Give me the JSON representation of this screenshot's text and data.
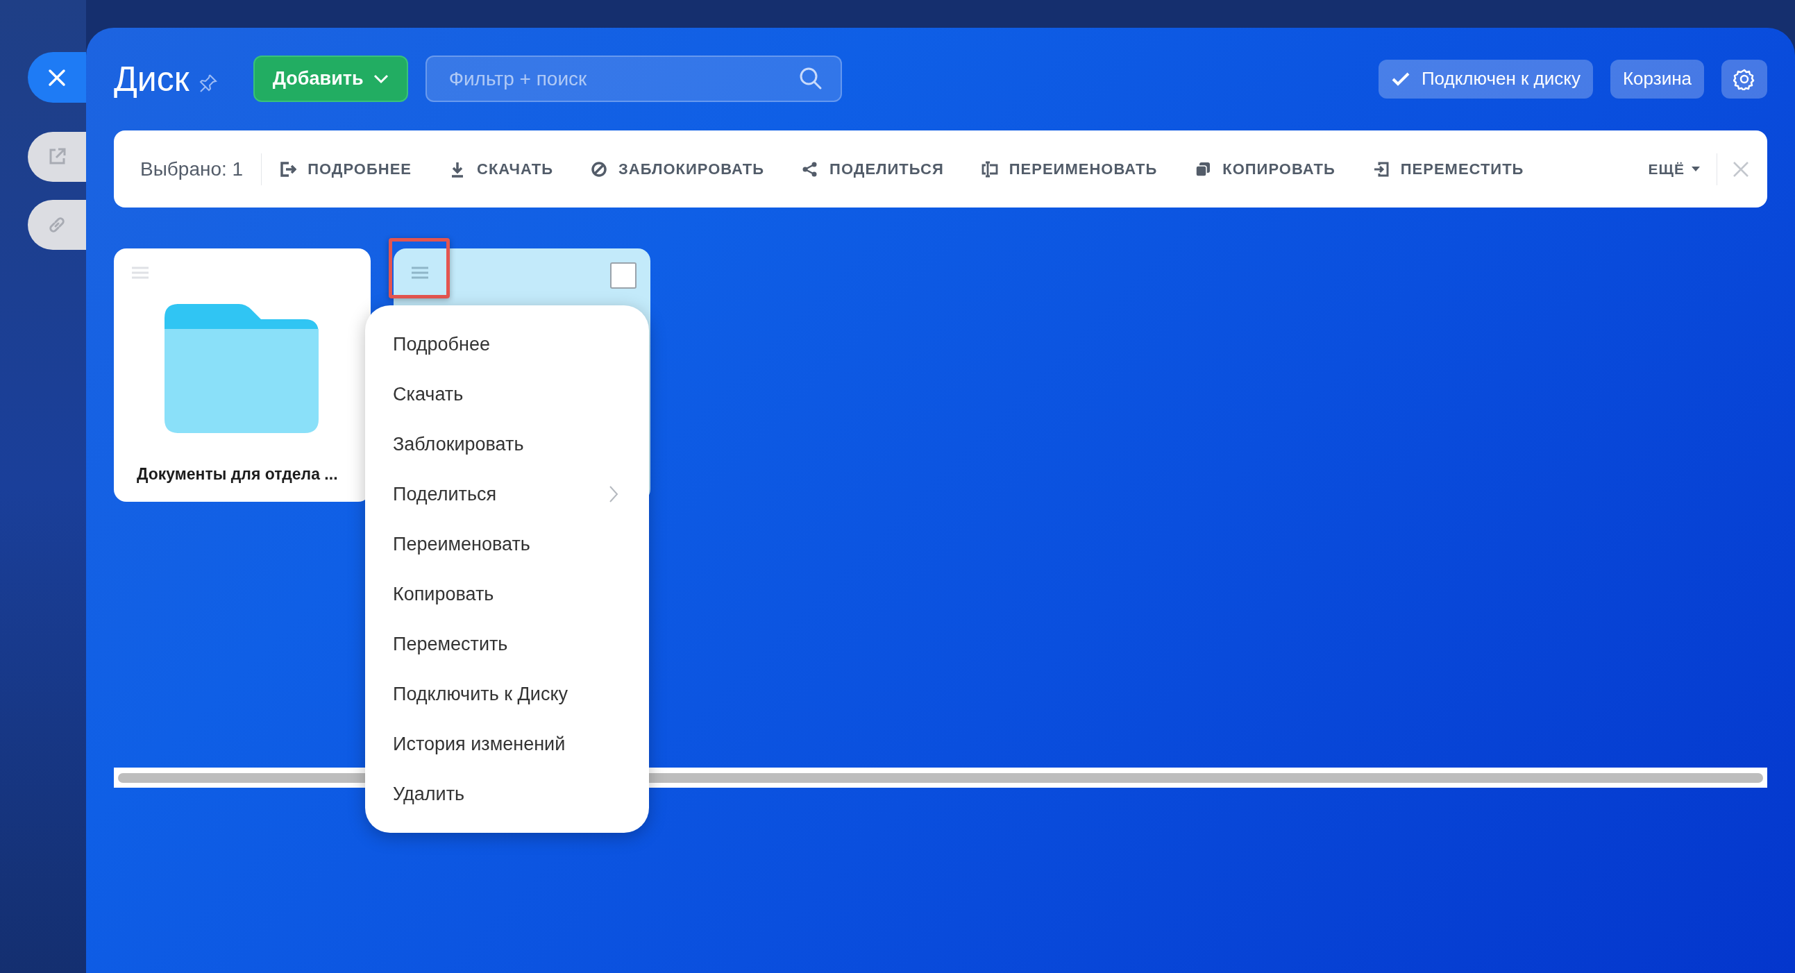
{
  "header": {
    "title": "Диск",
    "add_button": "Добавить",
    "search": {
      "placeholder": "Фильтр + поиск"
    },
    "connected_button": "Подключен к диску",
    "trash_button": "Корзина"
  },
  "toolbar": {
    "selected_count": "Выбрано: 1",
    "actions": [
      {
        "label": "ПОДРОБНЕЕ"
      },
      {
        "label": "СКАЧАТЬ"
      },
      {
        "label": "ЗАБЛОКИРОВАТЬ"
      },
      {
        "label": "ПОДЕЛИТЬСЯ"
      },
      {
        "label": "ПЕРЕИМЕНОВАТЬ"
      },
      {
        "label": "КОПИРОВАТЬ"
      },
      {
        "label": "ПЕРЕМЕСТИТЬ"
      }
    ],
    "more": "ЕЩЁ"
  },
  "cards": [
    {
      "name": "Документы для отдела ...",
      "selected": false,
      "checked": false
    },
    {
      "selected": true,
      "checked": false
    }
  ],
  "context_menu": [
    {
      "label": "Подробнее",
      "submenu": false
    },
    {
      "label": "Скачать",
      "submenu": false
    },
    {
      "label": "Заблокировать",
      "submenu": false
    },
    {
      "label": "Поделиться",
      "submenu": true
    },
    {
      "label": "Переименовать",
      "submenu": false
    },
    {
      "label": "Копировать",
      "submenu": false
    },
    {
      "label": "Переместить",
      "submenu": false
    },
    {
      "label": "Подключить к Диску",
      "submenu": false
    },
    {
      "label": "История изменений",
      "submenu": false
    },
    {
      "label": "Удалить",
      "submenu": false
    }
  ]
}
